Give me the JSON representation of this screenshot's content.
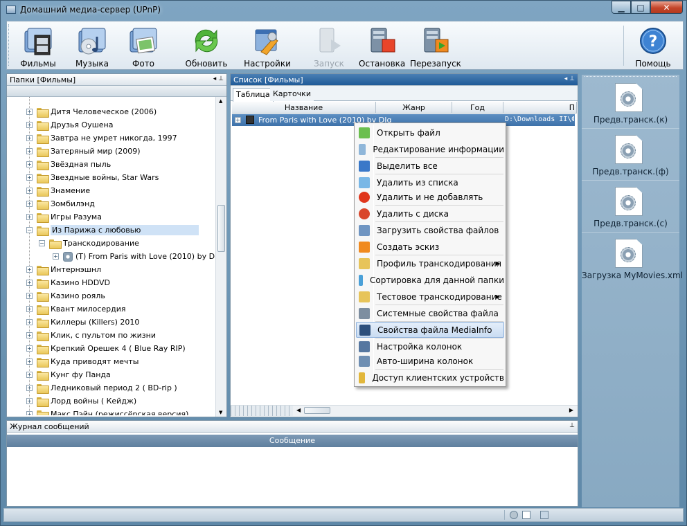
{
  "window": {
    "title": "Домашний медиа-сервер (UPnP)",
    "buttons": {
      "minimize": "▁",
      "maximize": "□",
      "close": "✕"
    }
  },
  "toolbar": {
    "items": [
      {
        "label": "Фильмы",
        "icon": "film-folder-icon",
        "enabled": true
      },
      {
        "label": "Музыка",
        "icon": "music-folder-icon",
        "enabled": true
      },
      {
        "label": "Фото",
        "icon": "photo-folder-icon",
        "enabled": true
      },
      {
        "label": "Обновить",
        "icon": "refresh-icon",
        "enabled": true
      },
      {
        "label": "Настройки",
        "icon": "settings-icon",
        "enabled": true
      },
      {
        "label": "Запуск",
        "icon": "start-server-icon",
        "enabled": false
      },
      {
        "label": "Остановка",
        "icon": "stop-server-icon",
        "enabled": true
      },
      {
        "label": "Перезапуск",
        "icon": "restart-server-icon",
        "enabled": true
      }
    ],
    "help": {
      "label": "Помощь",
      "icon": "help-icon"
    }
  },
  "folders": {
    "title": "Папки [Фильмы]",
    "items": [
      {
        "label": "Дитя Человеческое (2006)",
        "level": 0
      },
      {
        "label": "Друзья Оушена",
        "level": 0
      },
      {
        "label": "Завтра не умрет никогда, 1997",
        "level": 0
      },
      {
        "label": "Затеряный мир (2009)",
        "level": 0
      },
      {
        "label": "Звёздная пыль",
        "level": 0
      },
      {
        "label": "Звездные войны, Star Wars",
        "level": 0
      },
      {
        "label": "Знамение",
        "level": 0
      },
      {
        "label": "Зомбилэнд",
        "level": 0
      },
      {
        "label": "Игры Разума",
        "level": 0
      },
      {
        "label": "Из Парижа с любовью",
        "level": 0,
        "selected": true,
        "expanded": true
      },
      {
        "label": "Транскодирование",
        "level": 1,
        "expanded": true
      },
      {
        "label": "(T) From Paris with Love (2010) by D",
        "level": 2
      },
      {
        "label": "Интернэшнл",
        "level": 0
      },
      {
        "label": "Казино HDDVD",
        "level": 0
      },
      {
        "label": "Казино рояль",
        "level": 0
      },
      {
        "label": "Квант милосердия",
        "level": 0
      },
      {
        "label": "Киллеры (Killers) 2010",
        "level": 0
      },
      {
        "label": "Клик, с пультом по жизни",
        "level": 0
      },
      {
        "label": "Крепкий Орешек 4 ( Blue Ray RIP)",
        "level": 0
      },
      {
        "label": "Куда приводят мечты",
        "level": 0
      },
      {
        "label": "Кунг фу Панда",
        "level": 0
      },
      {
        "label": "Ледниковый период 2 ( BD-rip )",
        "level": 0
      },
      {
        "label": "Лорд войны ( Кейдж)",
        "level": 0
      },
      {
        "label": "Макс Пэйн (режиссёрская версия)",
        "level": 0
      }
    ]
  },
  "list": {
    "title": "Список [Фильмы]",
    "tabs": [
      "Таблица",
      "Карточки"
    ],
    "columns": [
      "Название",
      "Жанр",
      "Год",
      "П"
    ],
    "rows": [
      {
        "name": "From Paris with Love (2010) by DIg",
        "path": "D:\\Downloads II\\Фильм"
      }
    ]
  },
  "context_menu": {
    "items": [
      {
        "label": "Открыть файл",
        "icon": "open-file-icon"
      },
      {
        "label": "Редактирование информации",
        "icon": "edit-info-icon"
      },
      {
        "label": "Выделить все",
        "icon": "select-all-icon"
      },
      {
        "label": "Удалить из списка",
        "icon": "remove-from-list-icon"
      },
      {
        "label": "Удалить и не добавлять",
        "icon": "delete-red-x-icon"
      },
      {
        "label": "Удалить с диска",
        "icon": "delete-from-disk-icon"
      },
      {
        "label": "Загрузить свойства файлов",
        "icon": "load-properties-icon"
      },
      {
        "label": "Создать эскиз",
        "icon": "create-thumbnail-icon"
      },
      {
        "label": "Профиль транскодирования",
        "icon": "transcode-profile-icon",
        "submenu": true
      },
      {
        "label": "Сортировка для данной папки",
        "icon": "sort-icon"
      },
      {
        "label": "Тестовое транскодирование",
        "icon": "test-transcode-icon",
        "submenu": true
      },
      {
        "label": "Системные свойства файла",
        "icon": "system-properties-icon"
      },
      {
        "label": "Свойства файла MediaInfo",
        "icon": "mediainfo-icon",
        "highlighted": true
      },
      {
        "label": "Настройка колонок",
        "icon": "columns-settings-icon"
      },
      {
        "label": "Авто-ширина колонок",
        "icon": "auto-width-icon"
      },
      {
        "label": "Доступ клиентских устройств",
        "icon": "client-access-key-icon"
      }
    ]
  },
  "right_panel": {
    "items": [
      "Предв.транск.(к)",
      "Предв.транск.(ф)",
      "Предв.транск.(с)",
      "Загрузка MyMovies.xml"
    ]
  },
  "log": {
    "title": "Журнал сообщений",
    "column": "Сообщение"
  },
  "colors": {
    "accent": "#2f68a4",
    "selection": "#4a7fb8",
    "menu_highlight": "#c9dcf2"
  }
}
